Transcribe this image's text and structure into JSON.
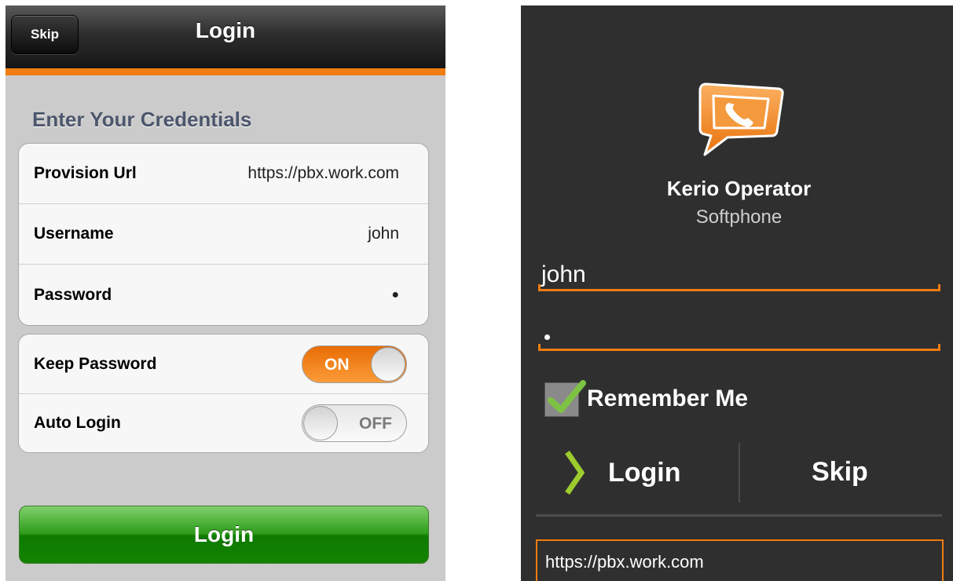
{
  "ios": {
    "nav": {
      "skip_label": "Skip",
      "title": "Login"
    },
    "section_title": "Enter Your Credentials",
    "credentials": [
      {
        "label": "Provision Url",
        "value": "https://pbx.work.com"
      },
      {
        "label": "Username",
        "value": "john"
      },
      {
        "label": "Password",
        "value": "●"
      }
    ],
    "options": [
      {
        "label": "Keep Password",
        "state": "ON"
      },
      {
        "label": "Auto Login",
        "state": "OFF"
      }
    ],
    "login_button": "Login",
    "colors": {
      "accent": "#f07d12",
      "login_green": "#2e9c1a",
      "section_title": "#4c566c"
    }
  },
  "android": {
    "logo_icon": "phone-speech-bubble-icon",
    "app_name": "Kerio Operator",
    "app_subtitle": "Softphone",
    "username_value": "john",
    "password_value": "•",
    "remember_label": "Remember Me",
    "remember_checked": true,
    "login_label": "Login",
    "skip_label": "Skip",
    "url_value": "https://pbx.work.com",
    "colors": {
      "background": "#2f2f2f",
      "accent": "#f07d12",
      "check": "#7dc243"
    }
  }
}
